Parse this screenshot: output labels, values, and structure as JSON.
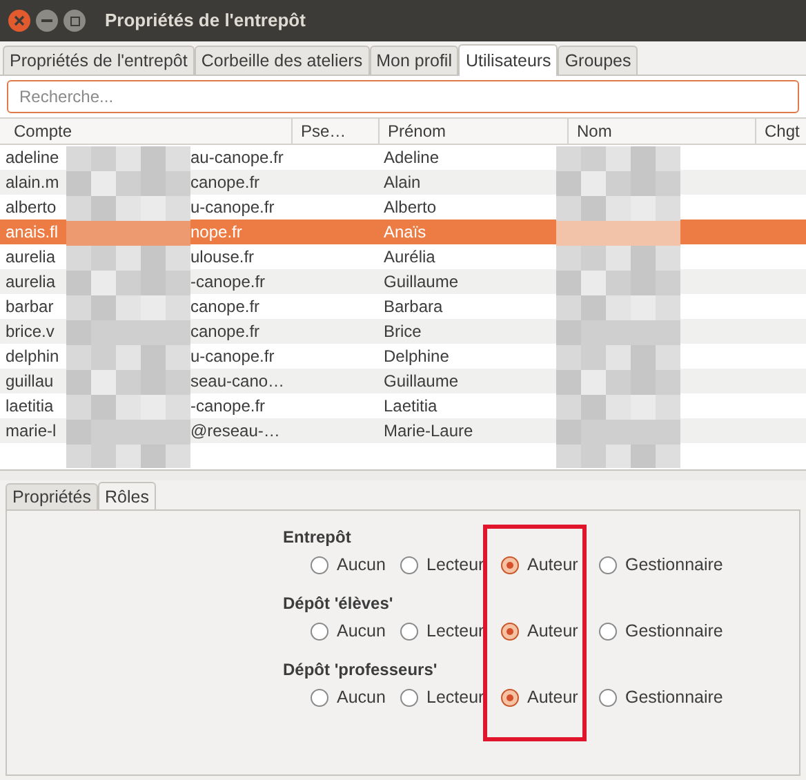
{
  "window": {
    "title": "Propriétés de l'entrepôt"
  },
  "tabs": [
    {
      "label": "Propriétés de l'entrepôt",
      "selected": false
    },
    {
      "label": "Corbeille des ateliers",
      "selected": false
    },
    {
      "label": "Mon profil",
      "selected": false
    },
    {
      "label": "Utilisateurs",
      "selected": true
    },
    {
      "label": "Groupes",
      "selected": false
    }
  ],
  "search": {
    "placeholder": "Recherche..."
  },
  "table": {
    "columns": [
      "Compte",
      "Pse…",
      "Prénom",
      "Nom",
      "Chgt"
    ],
    "rows": [
      {
        "account_start": "adeline",
        "account_end": "au-canope.fr",
        "first_name": "Adeline",
        "selected": false
      },
      {
        "account_start": "alain.m",
        "account_end": "canope.fr",
        "first_name": "Alain",
        "selected": false
      },
      {
        "account_start": "alberto",
        "account_end": "u-canope.fr",
        "first_name": "Alberto",
        "selected": false
      },
      {
        "account_start": "anais.fl",
        "account_end": "nope.fr",
        "first_name": "Anaïs",
        "selected": true
      },
      {
        "account_start": "aurelia",
        "account_end": "ulouse.fr",
        "first_name": "Aurélia",
        "selected": false
      },
      {
        "account_start": "aurelia",
        "account_end": "-canope.fr",
        "first_name": "Guillaume",
        "selected": false
      },
      {
        "account_start": "barbar",
        "account_end": "canope.fr",
        "first_name": "Barbara",
        "selected": false
      },
      {
        "account_start": "brice.v",
        "account_end": "canope.fr",
        "first_name": "Brice",
        "selected": false
      },
      {
        "account_start": "delphin",
        "account_end": "u-canope.fr",
        "first_name": "Delphine",
        "selected": false
      },
      {
        "account_start": "guillau",
        "account_end": "seau-cano…",
        "first_name": "Guillaume",
        "selected": false
      },
      {
        "account_start": "laetitia",
        "account_end": "-canope.fr",
        "first_name": "Laetitia",
        "selected": false
      },
      {
        "account_start": "marie-l",
        "account_end": "@reseau-…",
        "first_name": "Marie-Laure",
        "selected": false
      }
    ]
  },
  "detail_tabs": [
    {
      "label": "Propriétés",
      "selected": false
    },
    {
      "label": "Rôles",
      "selected": true
    }
  ],
  "roles": [
    {
      "label": "Entrepôt",
      "options": [
        {
          "label": "Aucun",
          "selected": false
        },
        {
          "label": "Lecteur",
          "selected": false
        },
        {
          "label": "Auteur",
          "selected": true
        },
        {
          "label": "Gestionnaire",
          "selected": false
        }
      ]
    },
    {
      "label": "Dépôt 'élèves'",
      "options": [
        {
          "label": "Aucun",
          "selected": false
        },
        {
          "label": "Lecteur",
          "selected": false
        },
        {
          "label": "Auteur",
          "selected": true
        },
        {
          "label": "Gestionnaire",
          "selected": false
        }
      ]
    },
    {
      "label": "Dépôt 'professeurs'",
      "options": [
        {
          "label": "Aucun",
          "selected": false
        },
        {
          "label": "Lecteur",
          "selected": false
        },
        {
          "label": "Auteur",
          "selected": true
        },
        {
          "label": "Gestionnaire",
          "selected": false
        }
      ]
    }
  ]
}
